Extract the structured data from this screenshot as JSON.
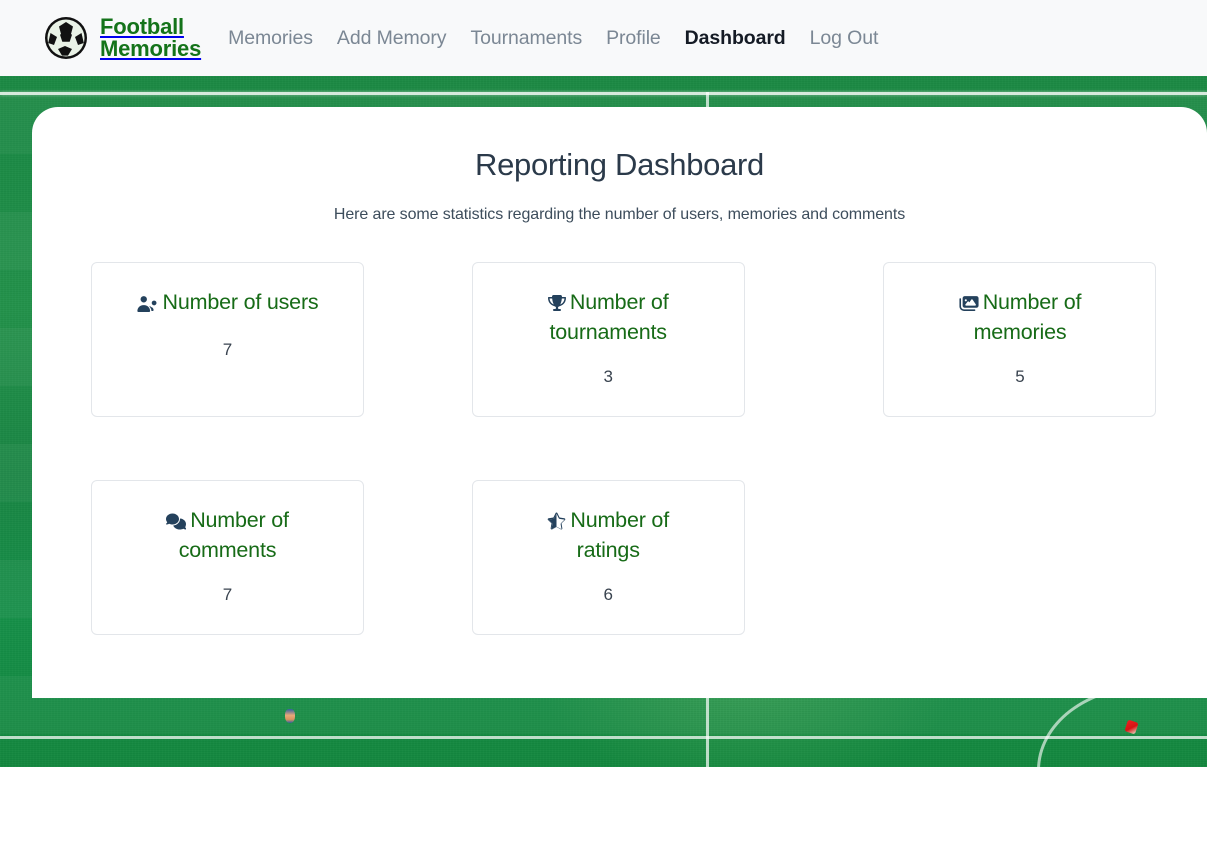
{
  "brand": {
    "icon": "soccer-ball-icon",
    "line1": "Football",
    "line2": "Memories",
    "color": "#14731a"
  },
  "nav": {
    "items": [
      {
        "label": "Memories",
        "active": false
      },
      {
        "label": "Add Memory",
        "active": false
      },
      {
        "label": "Tournaments",
        "active": false
      },
      {
        "label": "Profile",
        "active": false
      },
      {
        "label": "Dashboard",
        "active": true
      },
      {
        "label": "Log Out",
        "active": false
      }
    ],
    "inactive_color": "#7b8794",
    "active_color": "#151b25"
  },
  "main": {
    "title": "Reporting Dashboard",
    "subtitle": "Here are some statistics regarding the number of users, memories and comments",
    "title_color": "#2b3a4a"
  },
  "cards": [
    {
      "icon": "users-icon",
      "title": "Number of users",
      "value": "7"
    },
    {
      "icon": "trophy-icon",
      "title": "Number of tournaments",
      "value": "3"
    },
    {
      "icon": "images-icon",
      "title": "Number of memories",
      "value": "5"
    },
    {
      "icon": "comments-icon",
      "title": "Number of comments",
      "value": "7"
    },
    {
      "icon": "star-half-icon",
      "title": "Number of ratings",
      "value": "6"
    }
  ],
  "card_style": {
    "title_color": "#176b17",
    "icon_color": "#24415c",
    "value_color": "#39434f",
    "border_color": "#e3e6ea"
  },
  "background": {
    "type": "football-pitch-aerial-photo",
    "grass_color": "#1d8a42",
    "line_color": "#ffffff"
  }
}
